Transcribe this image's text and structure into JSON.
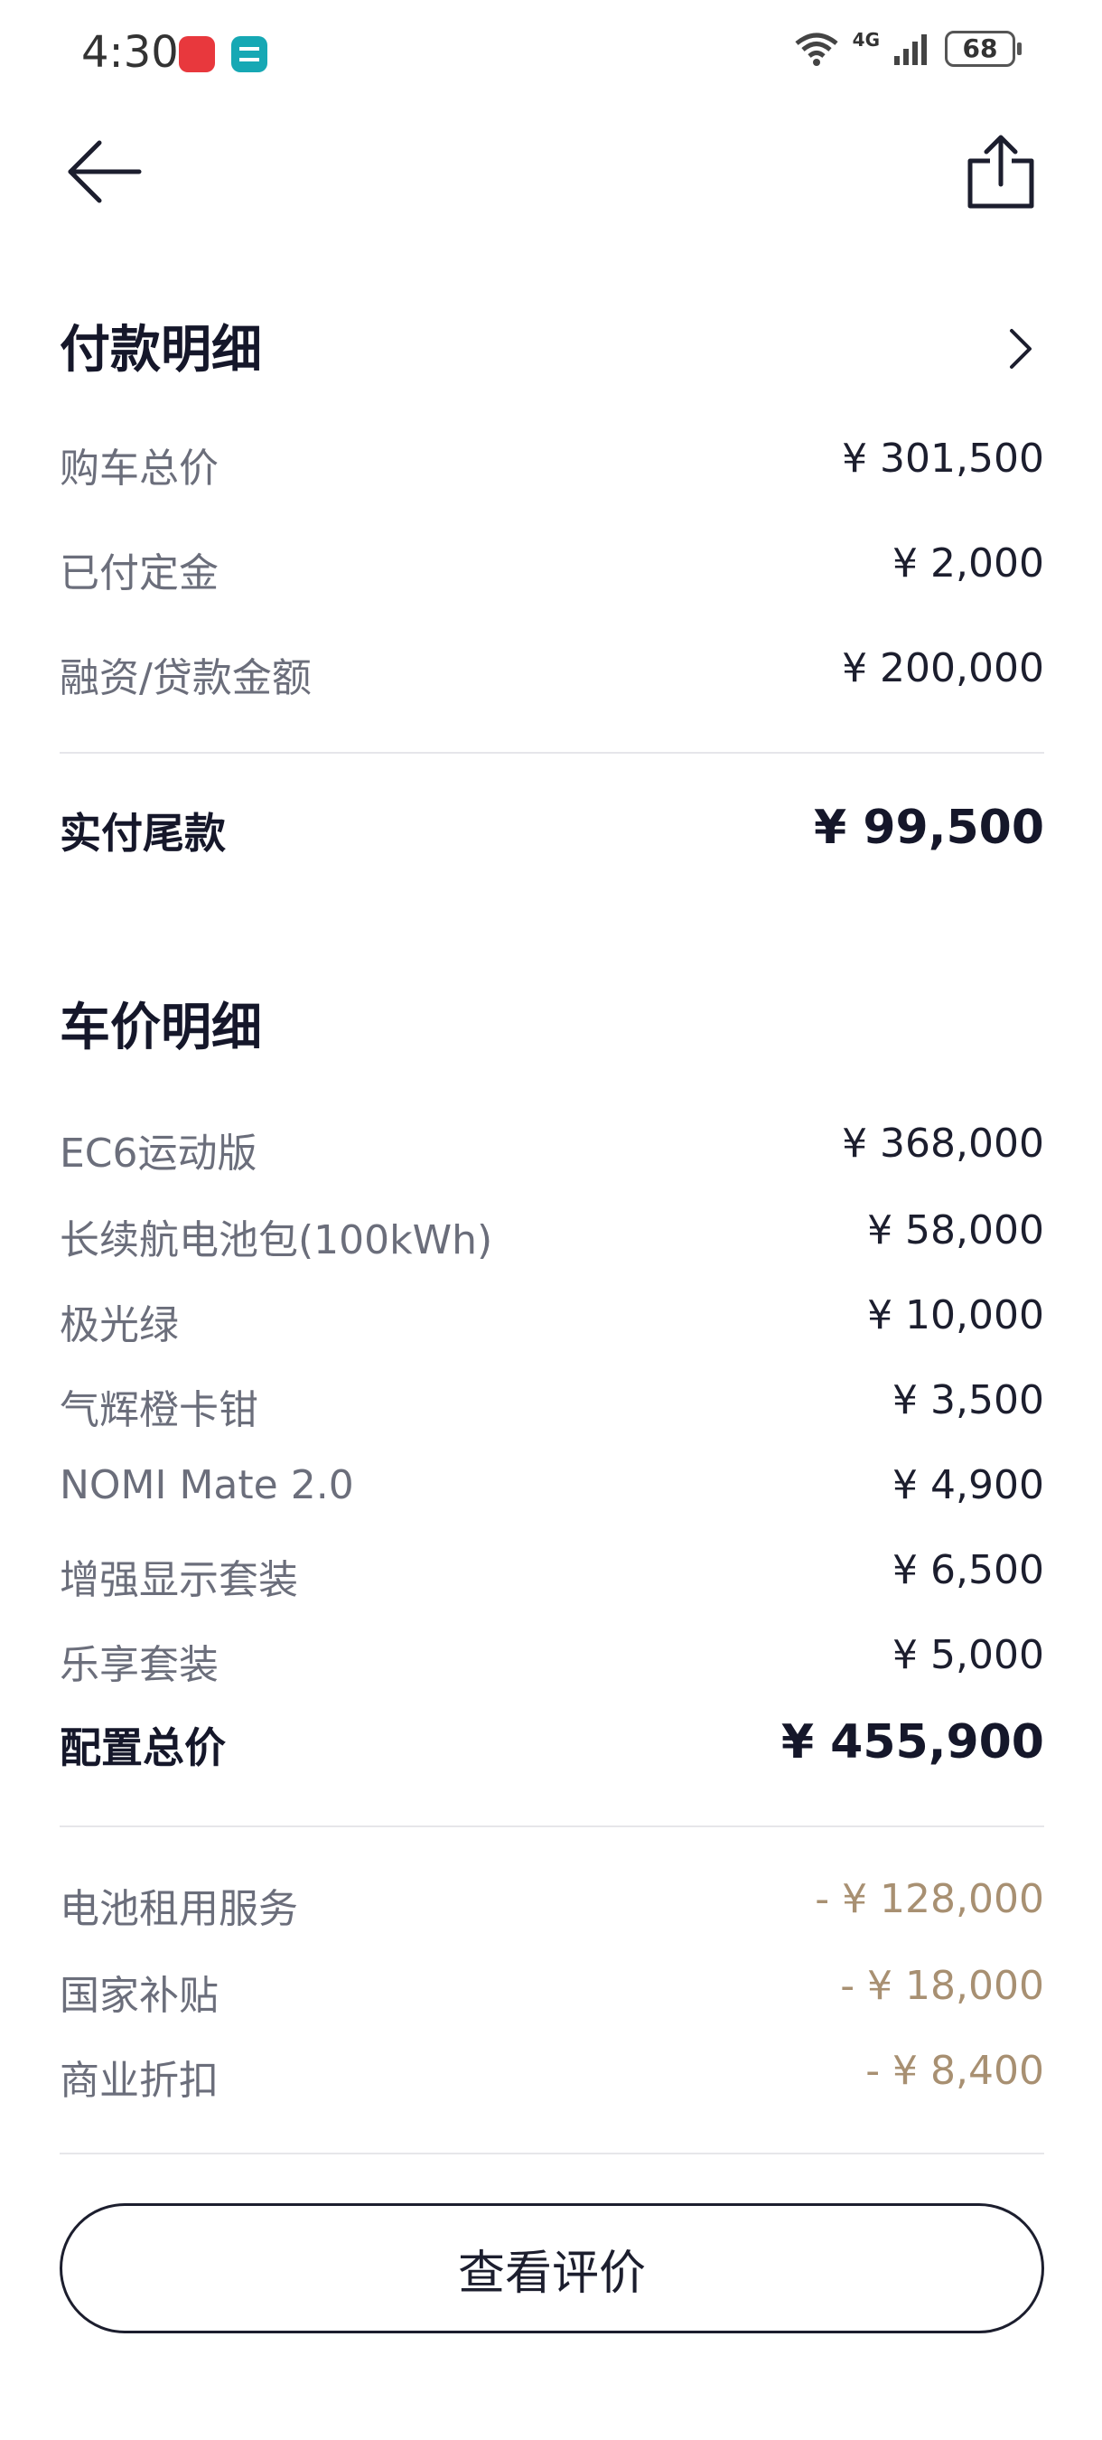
{
  "status": {
    "time": "4:30",
    "network": "4G",
    "battery": "68"
  },
  "payment": {
    "title": "付款明细",
    "rows": [
      {
        "label": "购车总价",
        "value": "¥ 301,500"
      },
      {
        "label": "已付定金",
        "value": "¥ 2,000"
      },
      {
        "label": "融资/贷款金额",
        "value": "¥ 200,000"
      }
    ],
    "total": {
      "label": "实付尾款",
      "value": "¥ 99,500"
    }
  },
  "price": {
    "title": "车价明细",
    "rows": [
      {
        "label": "EC6运动版",
        "value": "¥ 368,000"
      },
      {
        "label": "长续航电池包(100kWh)",
        "value": "¥ 58,000"
      },
      {
        "label": "极光绿",
        "value": "¥ 10,000"
      },
      {
        "label": "气辉橙卡钳",
        "value": "¥ 3,500"
      },
      {
        "label": "NOMI Mate 2.0",
        "value": "¥ 4,900"
      },
      {
        "label": "增强显示套装",
        "value": "¥ 6,500"
      },
      {
        "label": "乐享套装",
        "value": "¥ 5,000"
      }
    ],
    "total": {
      "label": "配置总价",
      "value": "¥ 455,900"
    },
    "discounts": [
      {
        "label": "电池租用服务",
        "value": "- ¥ 128,000"
      },
      {
        "label": "国家补贴",
        "value": "- ¥ 18,000"
      },
      {
        "label": "商业折扣",
        "value": "- ¥ 8,400"
      }
    ]
  },
  "actions": {
    "review_label": "查看评价"
  },
  "colors": {
    "primary_text": "#15172a",
    "secondary_text": "#6b6e7b",
    "discount": "#a89072",
    "divider": "#e6e6ea"
  },
  "icons": [
    "back-arrow-icon",
    "share-icon",
    "chevron-right-icon",
    "wifi-icon",
    "signal-icon",
    "battery-icon"
  ]
}
